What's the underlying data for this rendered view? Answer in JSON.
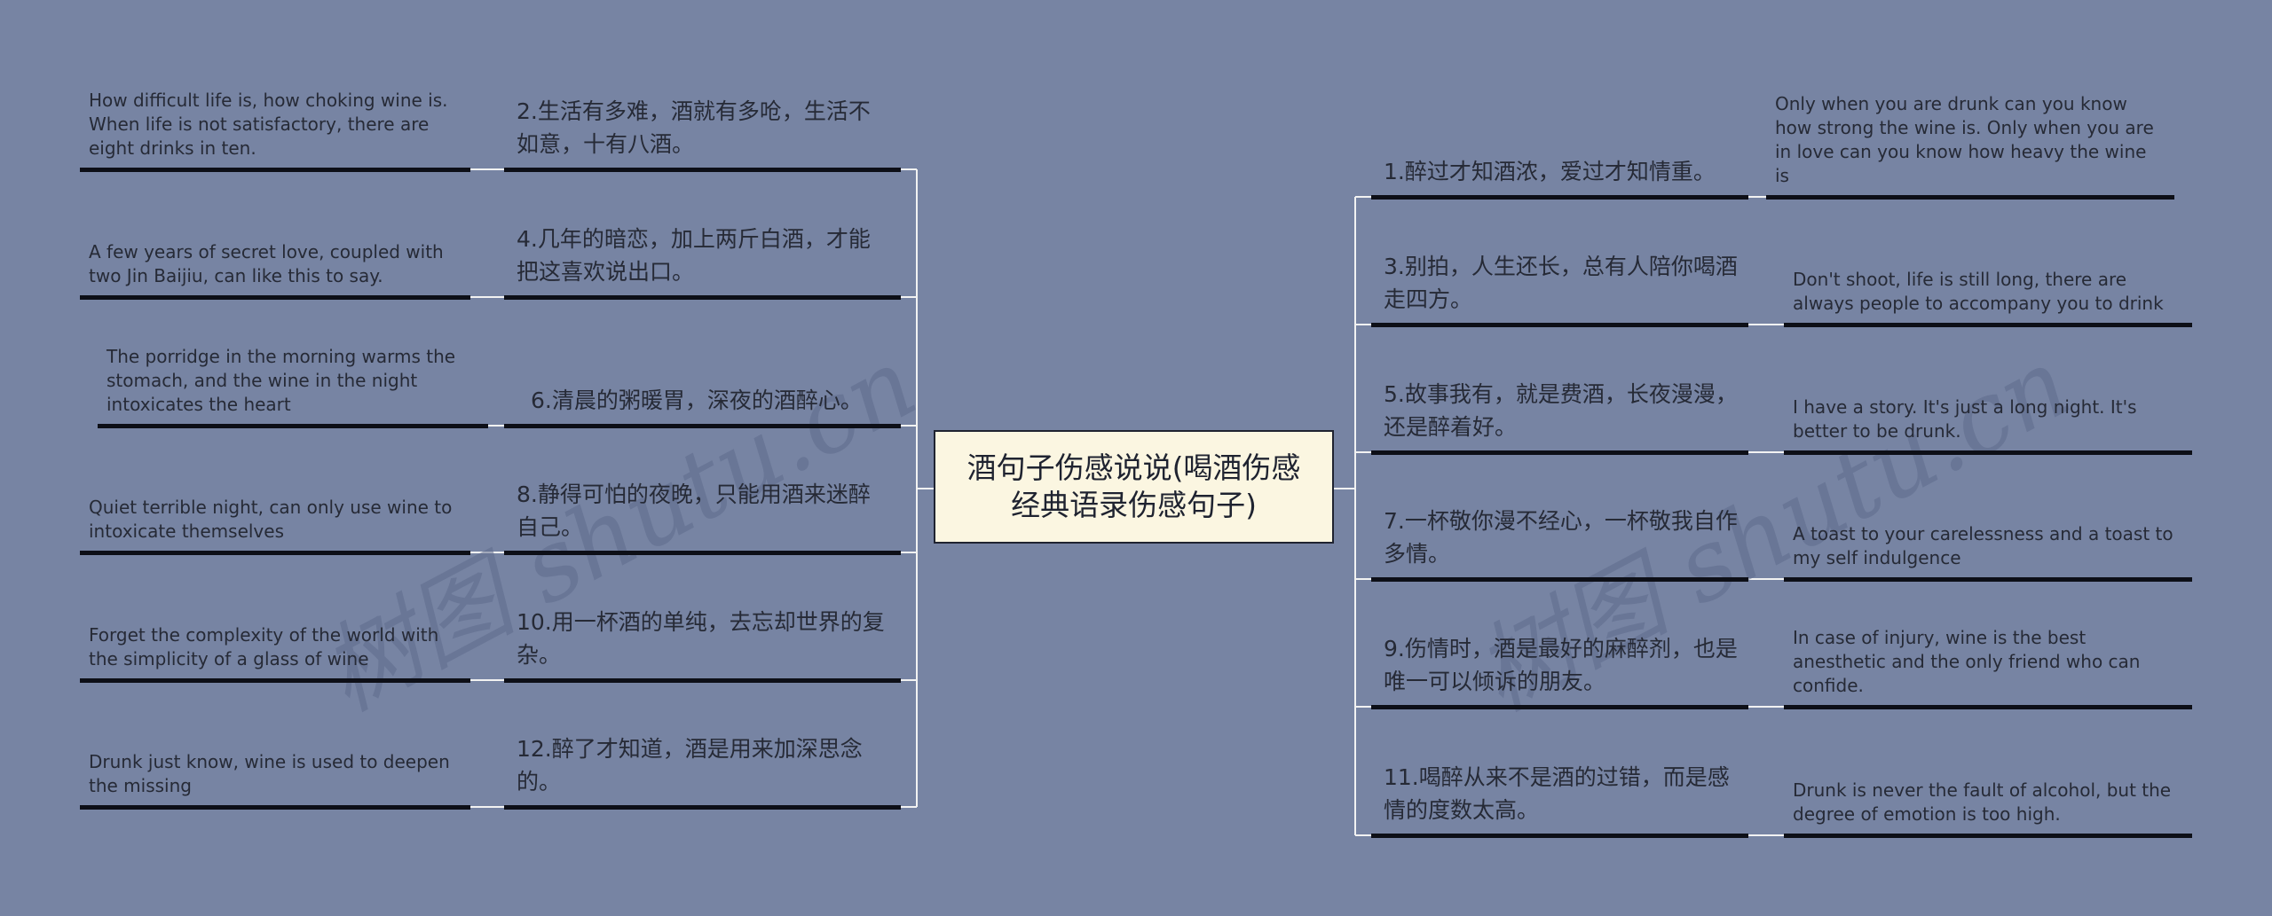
{
  "colors": {
    "background": "#7784a3",
    "root_fill": "#fbf6e1",
    "underline": "#0d0f17",
    "connector": "#f2f2f2",
    "text": "#262a36"
  },
  "root": {
    "label": "酒句子伤感说说(喝酒伤感经典语录伤感句子)"
  },
  "left_branches": [
    {
      "cn": "2.生活有多难，酒就有多呛，生活不如意，十有八酒。",
      "en": "How difficult life is, how choking wine is. When life is not satisfactory, there are eight drinks in ten."
    },
    {
      "cn": "4.几年的暗恋，加上两斤白酒，才能把这喜欢说出口。",
      "en": "A few years of secret love, coupled with two Jin Baijiu, can like this to say."
    },
    {
      "cn": "6.清晨的粥暖胃，深夜的酒醉心。",
      "en": "The porridge in the morning warms the stomach, and the wine in the night intoxicates the heart"
    },
    {
      "cn": "8.静得可怕的夜晚，只能用酒来迷醉自己。",
      "en": "Quiet terrible night, can only use wine to intoxicate themselves"
    },
    {
      "cn": "10.用一杯酒的单纯，去忘却世界的复杂。",
      "en": "Forget the complexity of the world with the simplicity of a glass of wine"
    },
    {
      "cn": "12.醉了才知道，酒是用来加深思念的。",
      "en": "Drunk just know, wine is used to deepen the missing"
    }
  ],
  "right_branches": [
    {
      "cn": "1.醉过才知酒浓，爱过才知情重。",
      "en": "Only when you are drunk can you know how strong the wine is. Only when you are in love can you know how heavy the wine is"
    },
    {
      "cn": "3.别拍，人生还长，总有人陪你喝酒走四方。",
      "en": "Don't shoot, life is still long, there are always people to accompany you to drink"
    },
    {
      "cn": "5.故事我有，就是费酒，长夜漫漫，还是醉着好。",
      "en": "I have a story. It's just a long night. It's better to be drunk."
    },
    {
      "cn": "7.一杯敬你漫不经心，一杯敬我自作多情。",
      "en": "A toast to your carelessness and a toast to my self indulgence"
    },
    {
      "cn": "9.伤情时，酒是最好的麻醉剂，也是唯一可以倾诉的朋友。",
      "en": "In case of injury, wine is the best anesthetic and the only friend who can confide."
    },
    {
      "cn": "11.喝醉从来不是酒的过错，而是感情的度数太高。",
      "en": "Drunk is never the fault of alcohol, but the degree of emotion is too high."
    }
  ],
  "watermarks": [
    "树图 shutu.cn",
    "树图 shutu.cn"
  ]
}
